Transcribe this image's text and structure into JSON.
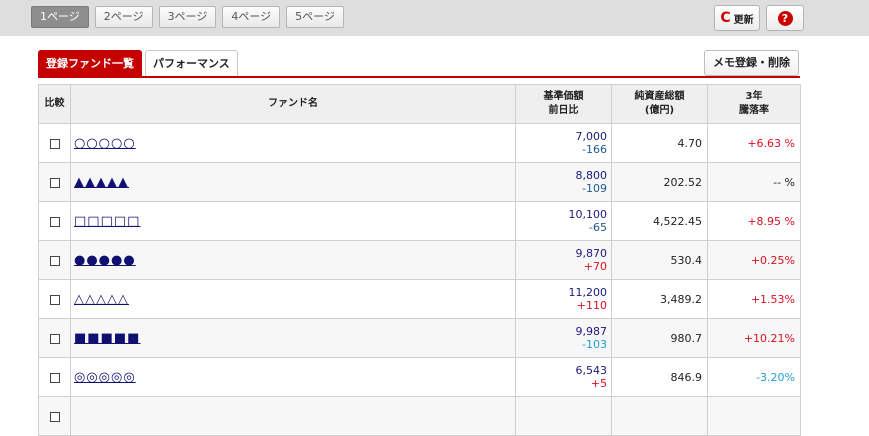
{
  "pager": [
    "1ページ",
    "2ページ",
    "3ページ",
    "4ページ",
    "5ページ"
  ],
  "refresh_label": "更新",
  "help_label": "?",
  "tabs": [
    "登録ファンド一覧",
    "パフォーマンス"
  ],
  "memo_label": "メモ登録・削除",
  "headers": {
    "compare": "比較",
    "fund_name": "ファンド名",
    "price_line1": "基準価額",
    "price_line2": "前日比",
    "assets_line1": "純資産総額",
    "assets_line2": "(億円)",
    "rate_line1": "3年",
    "rate_line2": "騰落率"
  },
  "rows": [
    {
      "name": "○○○○○",
      "price": "7,000",
      "change": "-166",
      "assets": "4.70",
      "rate": "+6.63 %"
    },
    {
      "name": "▲▲▲▲▲",
      "price": "8,800",
      "change": "-109",
      "assets": "202.52",
      "rate": "-- %"
    },
    {
      "name": "□□□□□",
      "price": "10,100",
      "change": "-65",
      "assets": "4,522.45",
      "rate": "+8.95 %"
    },
    {
      "name": "●●●●●",
      "price": "9,870",
      "change": "+70",
      "assets": "530.4",
      "rate": "+0.25%"
    },
    {
      "name": "△△△△△",
      "price": "11,200",
      "change": "+110",
      "assets": "3,489.2",
      "rate": "+1.53%"
    },
    {
      "name": "■■■■■",
      "price": "9,987",
      "change": "-103",
      "assets": "980.7",
      "rate": "+10.21%"
    },
    {
      "name": "◎◎◎◎◎",
      "price": "6,543",
      "change": "+5",
      "assets": "846.9",
      "rate": "-3.20%"
    },
    {
      "name": "",
      "price": "",
      "change": "",
      "assets": "",
      "rate": ""
    }
  ],
  "colors": {
    "accent": "#c40000",
    "up": "#d81020",
    "down": "#1fa0d8"
  }
}
